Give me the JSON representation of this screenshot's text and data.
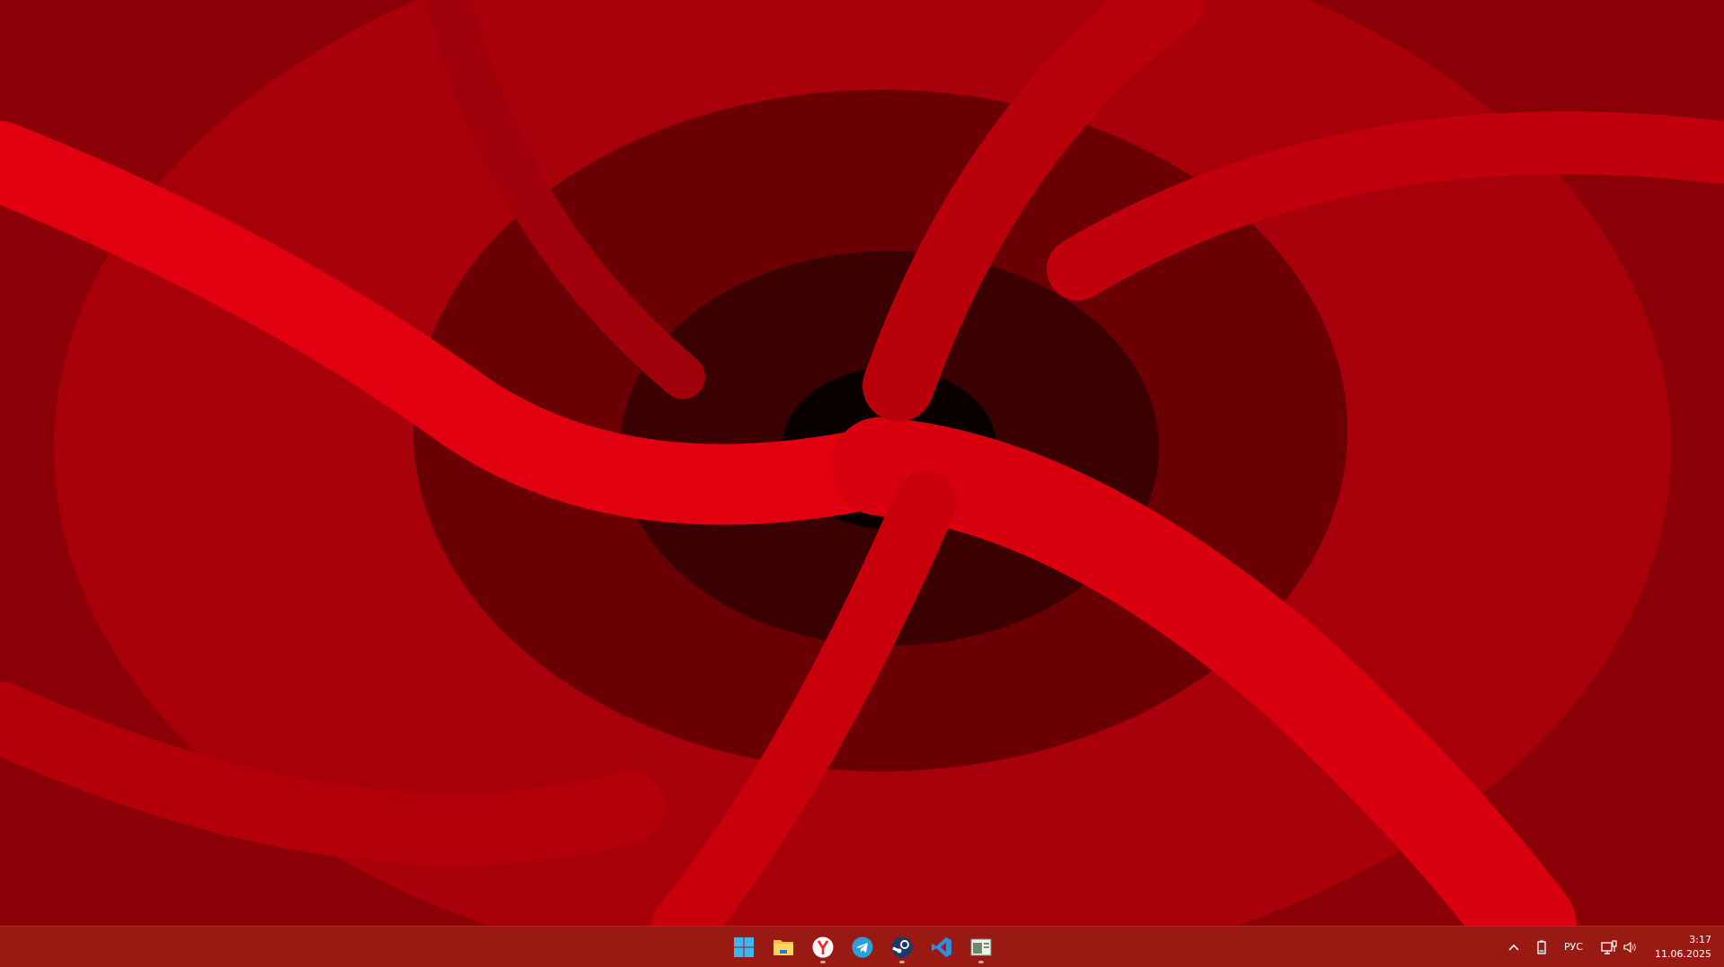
{
  "taskbar": {
    "apps": [
      {
        "kind": "start",
        "running": false
      },
      {
        "kind": "folder",
        "running": false
      },
      {
        "kind": "browser",
        "running": true
      },
      {
        "kind": "messenger",
        "running": false
      },
      {
        "kind": "game",
        "running": true
      },
      {
        "kind": "editor",
        "running": false
      },
      {
        "kind": "window",
        "running": true
      }
    ],
    "tray": {
      "language": "РУС",
      "time": "3:17",
      "date": "11.06.2025"
    }
  }
}
